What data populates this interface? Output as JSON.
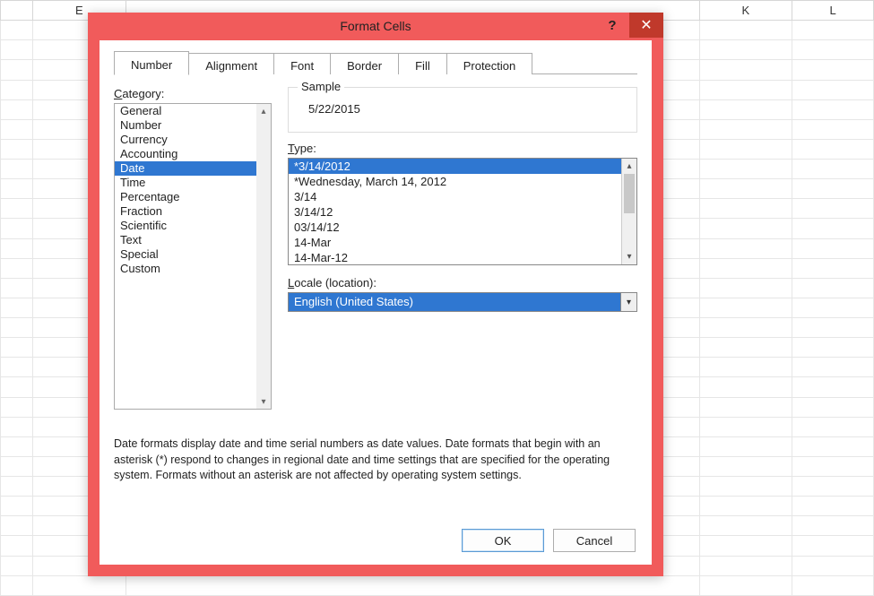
{
  "spreadsheet": {
    "column_headers": [
      "E",
      "K",
      "L"
    ]
  },
  "dialog": {
    "title": "Format Cells",
    "help_glyph": "?",
    "close_glyph": "✕",
    "tabs": [
      "Number",
      "Alignment",
      "Font",
      "Border",
      "Fill",
      "Protection"
    ],
    "active_tab": "Number",
    "category_label_pre": "C",
    "category_label_rest": "ategory:",
    "categories": [
      "General",
      "Number",
      "Currency",
      "Accounting",
      "Date",
      "Time",
      "Percentage",
      "Fraction",
      "Scientific",
      "Text",
      "Special",
      "Custom"
    ],
    "selected_category": "Date",
    "sample_label": "Sample",
    "sample_value": "5/22/2015",
    "type_label_pre": "T",
    "type_label_rest": "ype:",
    "types": [
      "*3/14/2012",
      "*Wednesday, March 14, 2012",
      "3/14",
      "3/14/12",
      "03/14/12",
      "14-Mar",
      "14-Mar-12"
    ],
    "selected_type": "*3/14/2012",
    "locale_label_pre": "L",
    "locale_label_rest": "ocale (location):",
    "locale_value": "English (United States)",
    "description": "Date formats display date and time serial numbers as date values.  Date formats that begin with an asterisk (*) respond to changes in regional date and time settings that are specified for the operating system. Formats without an asterisk are not affected by operating system settings.",
    "ok_label": "OK",
    "cancel_label": "Cancel"
  }
}
